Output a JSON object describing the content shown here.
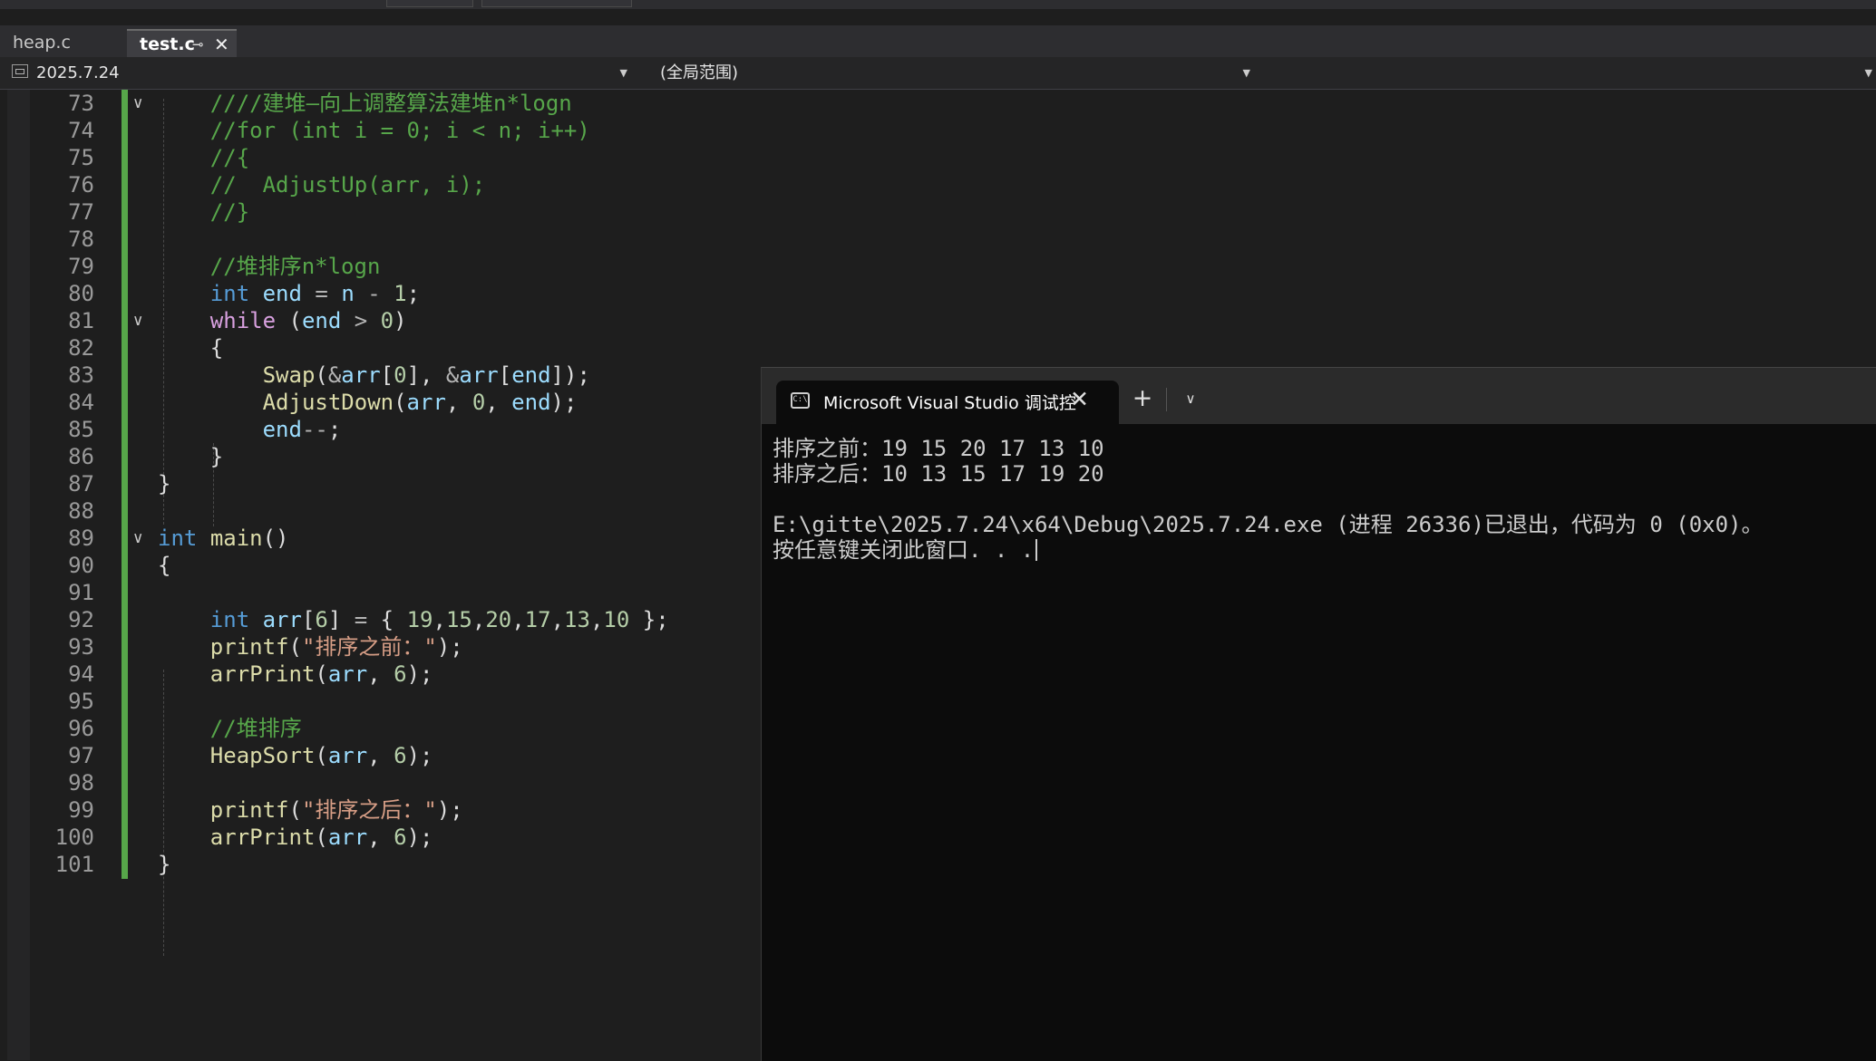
{
  "tabs": [
    {
      "label": "heap.c",
      "active": false
    },
    {
      "label": "test.c",
      "active": true,
      "pin_icon": "pin-icon",
      "close_icon": "close-icon"
    }
  ],
  "navbar": {
    "project": "2025.7.24",
    "scope": "(全局范围)",
    "member": ""
  },
  "editor": {
    "line_numbers": [
      "73",
      "74",
      "75",
      "76",
      "77",
      "78",
      "79",
      "80",
      "81",
      "82",
      "83",
      "84",
      "85",
      "86",
      "87",
      "88",
      "89",
      "90",
      "91",
      "92",
      "93",
      "94",
      "95",
      "96",
      "97",
      "98",
      "99",
      "100",
      "101"
    ],
    "colors": {
      "comment": "#57a64a",
      "keyword": "#569cd6",
      "control": "#d8a0df",
      "function": "#dcdcaa",
      "variable": "#9cdcfe",
      "number": "#b5cea8",
      "string": "#d69d85",
      "change_bar": "#57a64a"
    },
    "lines": [
      [
        [
          "cm",
          "    ////建堆—向上调整算法建堆n*logn"
        ]
      ],
      [
        [
          "cm",
          "    //for (int i = 0; i < n; i++)"
        ]
      ],
      [
        [
          "cm",
          "    //{"
        ]
      ],
      [
        [
          "cm",
          "    //  AdjustUp(arr, i);"
        ]
      ],
      [
        [
          "cm",
          "    //}"
        ]
      ],
      [
        [
          "pl",
          ""
        ]
      ],
      [
        [
          "cm",
          "    //堆排序n*logn"
        ]
      ],
      [
        [
          "pl",
          "    "
        ],
        [
          "kw",
          "int"
        ],
        [
          "pl",
          " "
        ],
        [
          "var",
          "end"
        ],
        [
          "pl",
          " "
        ],
        [
          "op",
          "="
        ],
        [
          "pl",
          " "
        ],
        [
          "var",
          "n"
        ],
        [
          "pl",
          " "
        ],
        [
          "op",
          "-"
        ],
        [
          "pl",
          " "
        ],
        [
          "num",
          "1"
        ],
        [
          "pl",
          ";"
        ]
      ],
      [
        [
          "pl",
          "    "
        ],
        [
          "ctl",
          "while"
        ],
        [
          "pl",
          " ("
        ],
        [
          "var",
          "end"
        ],
        [
          "pl",
          " "
        ],
        [
          "op",
          ">"
        ],
        [
          "pl",
          " "
        ],
        [
          "num",
          "0"
        ],
        [
          "pl",
          ")"
        ]
      ],
      [
        [
          "pl",
          "    {"
        ]
      ],
      [
        [
          "pl",
          "        "
        ],
        [
          "fn",
          "Swap"
        ],
        [
          "pl",
          "("
        ],
        [
          "op",
          "&"
        ],
        [
          "var",
          "arr"
        ],
        [
          "pl",
          "["
        ],
        [
          "num",
          "0"
        ],
        [
          "pl",
          "], "
        ],
        [
          "op",
          "&"
        ],
        [
          "var",
          "arr"
        ],
        [
          "pl",
          "["
        ],
        [
          "var",
          "end"
        ],
        [
          "pl",
          "]);"
        ]
      ],
      [
        [
          "pl",
          "        "
        ],
        [
          "fn",
          "AdjustDown"
        ],
        [
          "pl",
          "("
        ],
        [
          "var",
          "arr"
        ],
        [
          "pl",
          ", "
        ],
        [
          "num",
          "0"
        ],
        [
          "pl",
          ", "
        ],
        [
          "var",
          "end"
        ],
        [
          "pl",
          ");"
        ]
      ],
      [
        [
          "pl",
          "        "
        ],
        [
          "var",
          "end"
        ],
        [
          "op",
          "--"
        ],
        [
          "pl",
          ";"
        ]
      ],
      [
        [
          "pl",
          "    }"
        ]
      ],
      [
        [
          "pl",
          "}"
        ]
      ],
      [
        [
          "pl",
          ""
        ]
      ],
      [
        [
          "kw",
          "int"
        ],
        [
          "pl",
          " "
        ],
        [
          "fn",
          "main"
        ],
        [
          "pl",
          "()"
        ]
      ],
      [
        [
          "pl",
          "{"
        ]
      ],
      [
        [
          "pl",
          ""
        ]
      ],
      [
        [
          "pl",
          "    "
        ],
        [
          "kw",
          "int"
        ],
        [
          "pl",
          " "
        ],
        [
          "var",
          "arr"
        ],
        [
          "pl",
          "["
        ],
        [
          "num",
          "6"
        ],
        [
          "pl",
          "] "
        ],
        [
          "op",
          "="
        ],
        [
          "pl",
          " { "
        ],
        [
          "num",
          "19"
        ],
        [
          "pl",
          ","
        ],
        [
          "num",
          "15"
        ],
        [
          "pl",
          ","
        ],
        [
          "num",
          "20"
        ],
        [
          "pl",
          ","
        ],
        [
          "num",
          "17"
        ],
        [
          "pl",
          ","
        ],
        [
          "num",
          "13"
        ],
        [
          "pl",
          ","
        ],
        [
          "num",
          "10"
        ],
        [
          "pl",
          " };"
        ]
      ],
      [
        [
          "pl",
          "    "
        ],
        [
          "fn",
          "printf"
        ],
        [
          "pl",
          "("
        ],
        [
          "str",
          "\"排序之前：\""
        ],
        [
          "pl",
          ");"
        ]
      ],
      [
        [
          "pl",
          "    "
        ],
        [
          "fn",
          "arrPrint"
        ],
        [
          "pl",
          "("
        ],
        [
          "var",
          "arr"
        ],
        [
          "pl",
          ", "
        ],
        [
          "num",
          "6"
        ],
        [
          "pl",
          ");"
        ]
      ],
      [
        [
          "pl",
          ""
        ]
      ],
      [
        [
          "cm",
          "    //堆排序"
        ]
      ],
      [
        [
          "pl",
          "    "
        ],
        [
          "fn",
          "HeapSort"
        ],
        [
          "pl",
          "("
        ],
        [
          "var",
          "arr"
        ],
        [
          "pl",
          ", "
        ],
        [
          "num",
          "6"
        ],
        [
          "pl",
          ");"
        ]
      ],
      [
        [
          "pl",
          ""
        ]
      ],
      [
        [
          "pl",
          "    "
        ],
        [
          "fn",
          "printf"
        ],
        [
          "pl",
          "("
        ],
        [
          "str",
          "\"排序之后：\""
        ],
        [
          "pl",
          ");"
        ]
      ],
      [
        [
          "pl",
          "    "
        ],
        [
          "fn",
          "arrPrint"
        ],
        [
          "pl",
          "("
        ],
        [
          "var",
          "arr"
        ],
        [
          "pl",
          ", "
        ],
        [
          "num",
          "6"
        ],
        [
          "pl",
          ");"
        ]
      ],
      [
        [
          "pl",
          "}"
        ]
      ]
    ]
  },
  "terminal": {
    "tab_title": "Microsoft Visual Studio 调试控",
    "tab_icon": "console-icon",
    "close_icon": "close-icon",
    "new_tab": "+",
    "dropdown": "⌄",
    "lines": [
      "排序之前：19 15 20 17 13 10",
      "排序之后：10 13 15 17 19 20",
      "",
      "E:\\gitte\\2025.7.24\\x64\\Debug\\2025.7.24.exe (进程 26336)已退出，代码为 0 (0x0)。",
      "按任意键关闭此窗口. . ."
    ]
  }
}
